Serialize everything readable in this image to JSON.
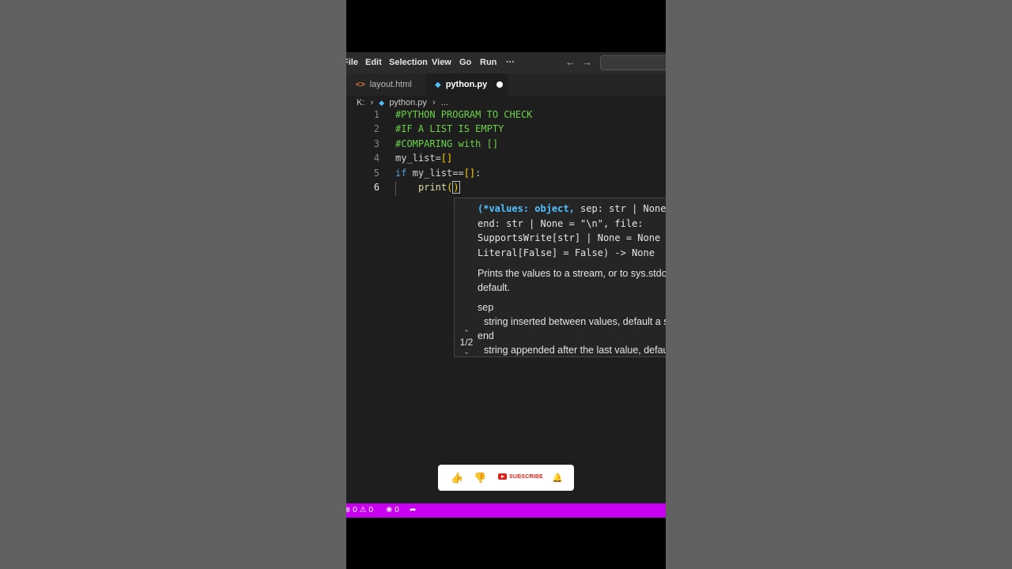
{
  "menu": {
    "items": [
      "File",
      "Edit",
      "Selection",
      "View",
      "Go",
      "Run",
      "···"
    ],
    "back_icon": "arrow-left-icon",
    "forward_icon": "arrow-right-icon"
  },
  "tabs": [
    {
      "label": "layout.html",
      "icon": "html-file-icon",
      "active": false
    },
    {
      "label": "python.py",
      "icon": "python-file-icon",
      "active": true,
      "unsaved": true
    }
  ],
  "breadcrumb": {
    "drive": "K:",
    "file": "python.py",
    "more": "..."
  },
  "editor": {
    "lines": [
      {
        "num": "1",
        "text": "#PYTHON PROGRAM TO CHECK"
      },
      {
        "num": "2",
        "text": "#IF A LIST IS EMPTY"
      },
      {
        "num": "3",
        "text": "#COMPARING with []"
      },
      {
        "num": "4",
        "text": "my_list=[]"
      },
      {
        "num": "5",
        "text": "if my_list==[]:"
      },
      {
        "num": "6",
        "text": "print()"
      }
    ]
  },
  "hover": {
    "sig_line1_hl": "(*values: object,",
    "sig_line1_rest": " sep: str | None",
    "sig_line2": "end: str | None = \"\\n\", file:",
    "sig_line3": "SupportsWrite[str] | None = None",
    "sig_line4": "Literal[False] = False) -> None",
    "doc_line1": "Prints the values to a stream, or to sys.stdout by",
    "doc_line2": "default.",
    "param1": "sep",
    "param1_desc": "string inserted between values, default a space.",
    "param2": "end",
    "param2_desc": "string appended after the last value, default a newline.",
    "pager": "1/2"
  },
  "subscribe_bar": {
    "like_icon": "thumbs-up-icon",
    "dislike_icon": "thumbs-down-icon",
    "subscribe_label": "SUBSCRIBE",
    "bell_icon": "bell-icon"
  },
  "status": {
    "errors": "0",
    "warnings": "0",
    "ports": "0"
  },
  "colors": {
    "status_bar": "#c800f0",
    "comment": "#6cd34a",
    "subscribe_red": "#e62117"
  }
}
